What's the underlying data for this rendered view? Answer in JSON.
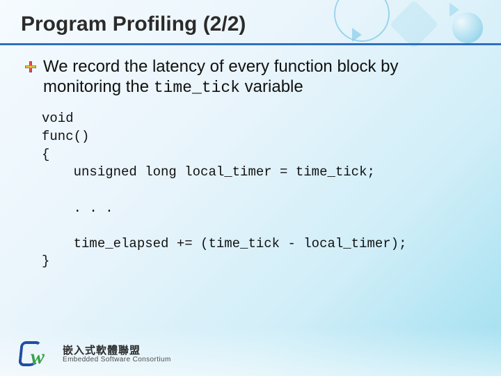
{
  "title": "Program Profiling (2/2)",
  "bullet": {
    "pre": "We record the latency of every function block by monitoring the ",
    "code_var": "time_tick",
    "post": " variable"
  },
  "code": {
    "l1": "void",
    "l2": "func()",
    "l3": "{",
    "l4": "    unsigned long local_timer = time_tick;",
    "l5": "",
    "l6": "    . . .",
    "l7": "",
    "l8": "    time_elapsed += (time_tick - local_timer);",
    "l9": "}"
  },
  "footer": {
    "zh": "嵌入式軟體聯盟",
    "en": "Embedded Software Consortium"
  }
}
